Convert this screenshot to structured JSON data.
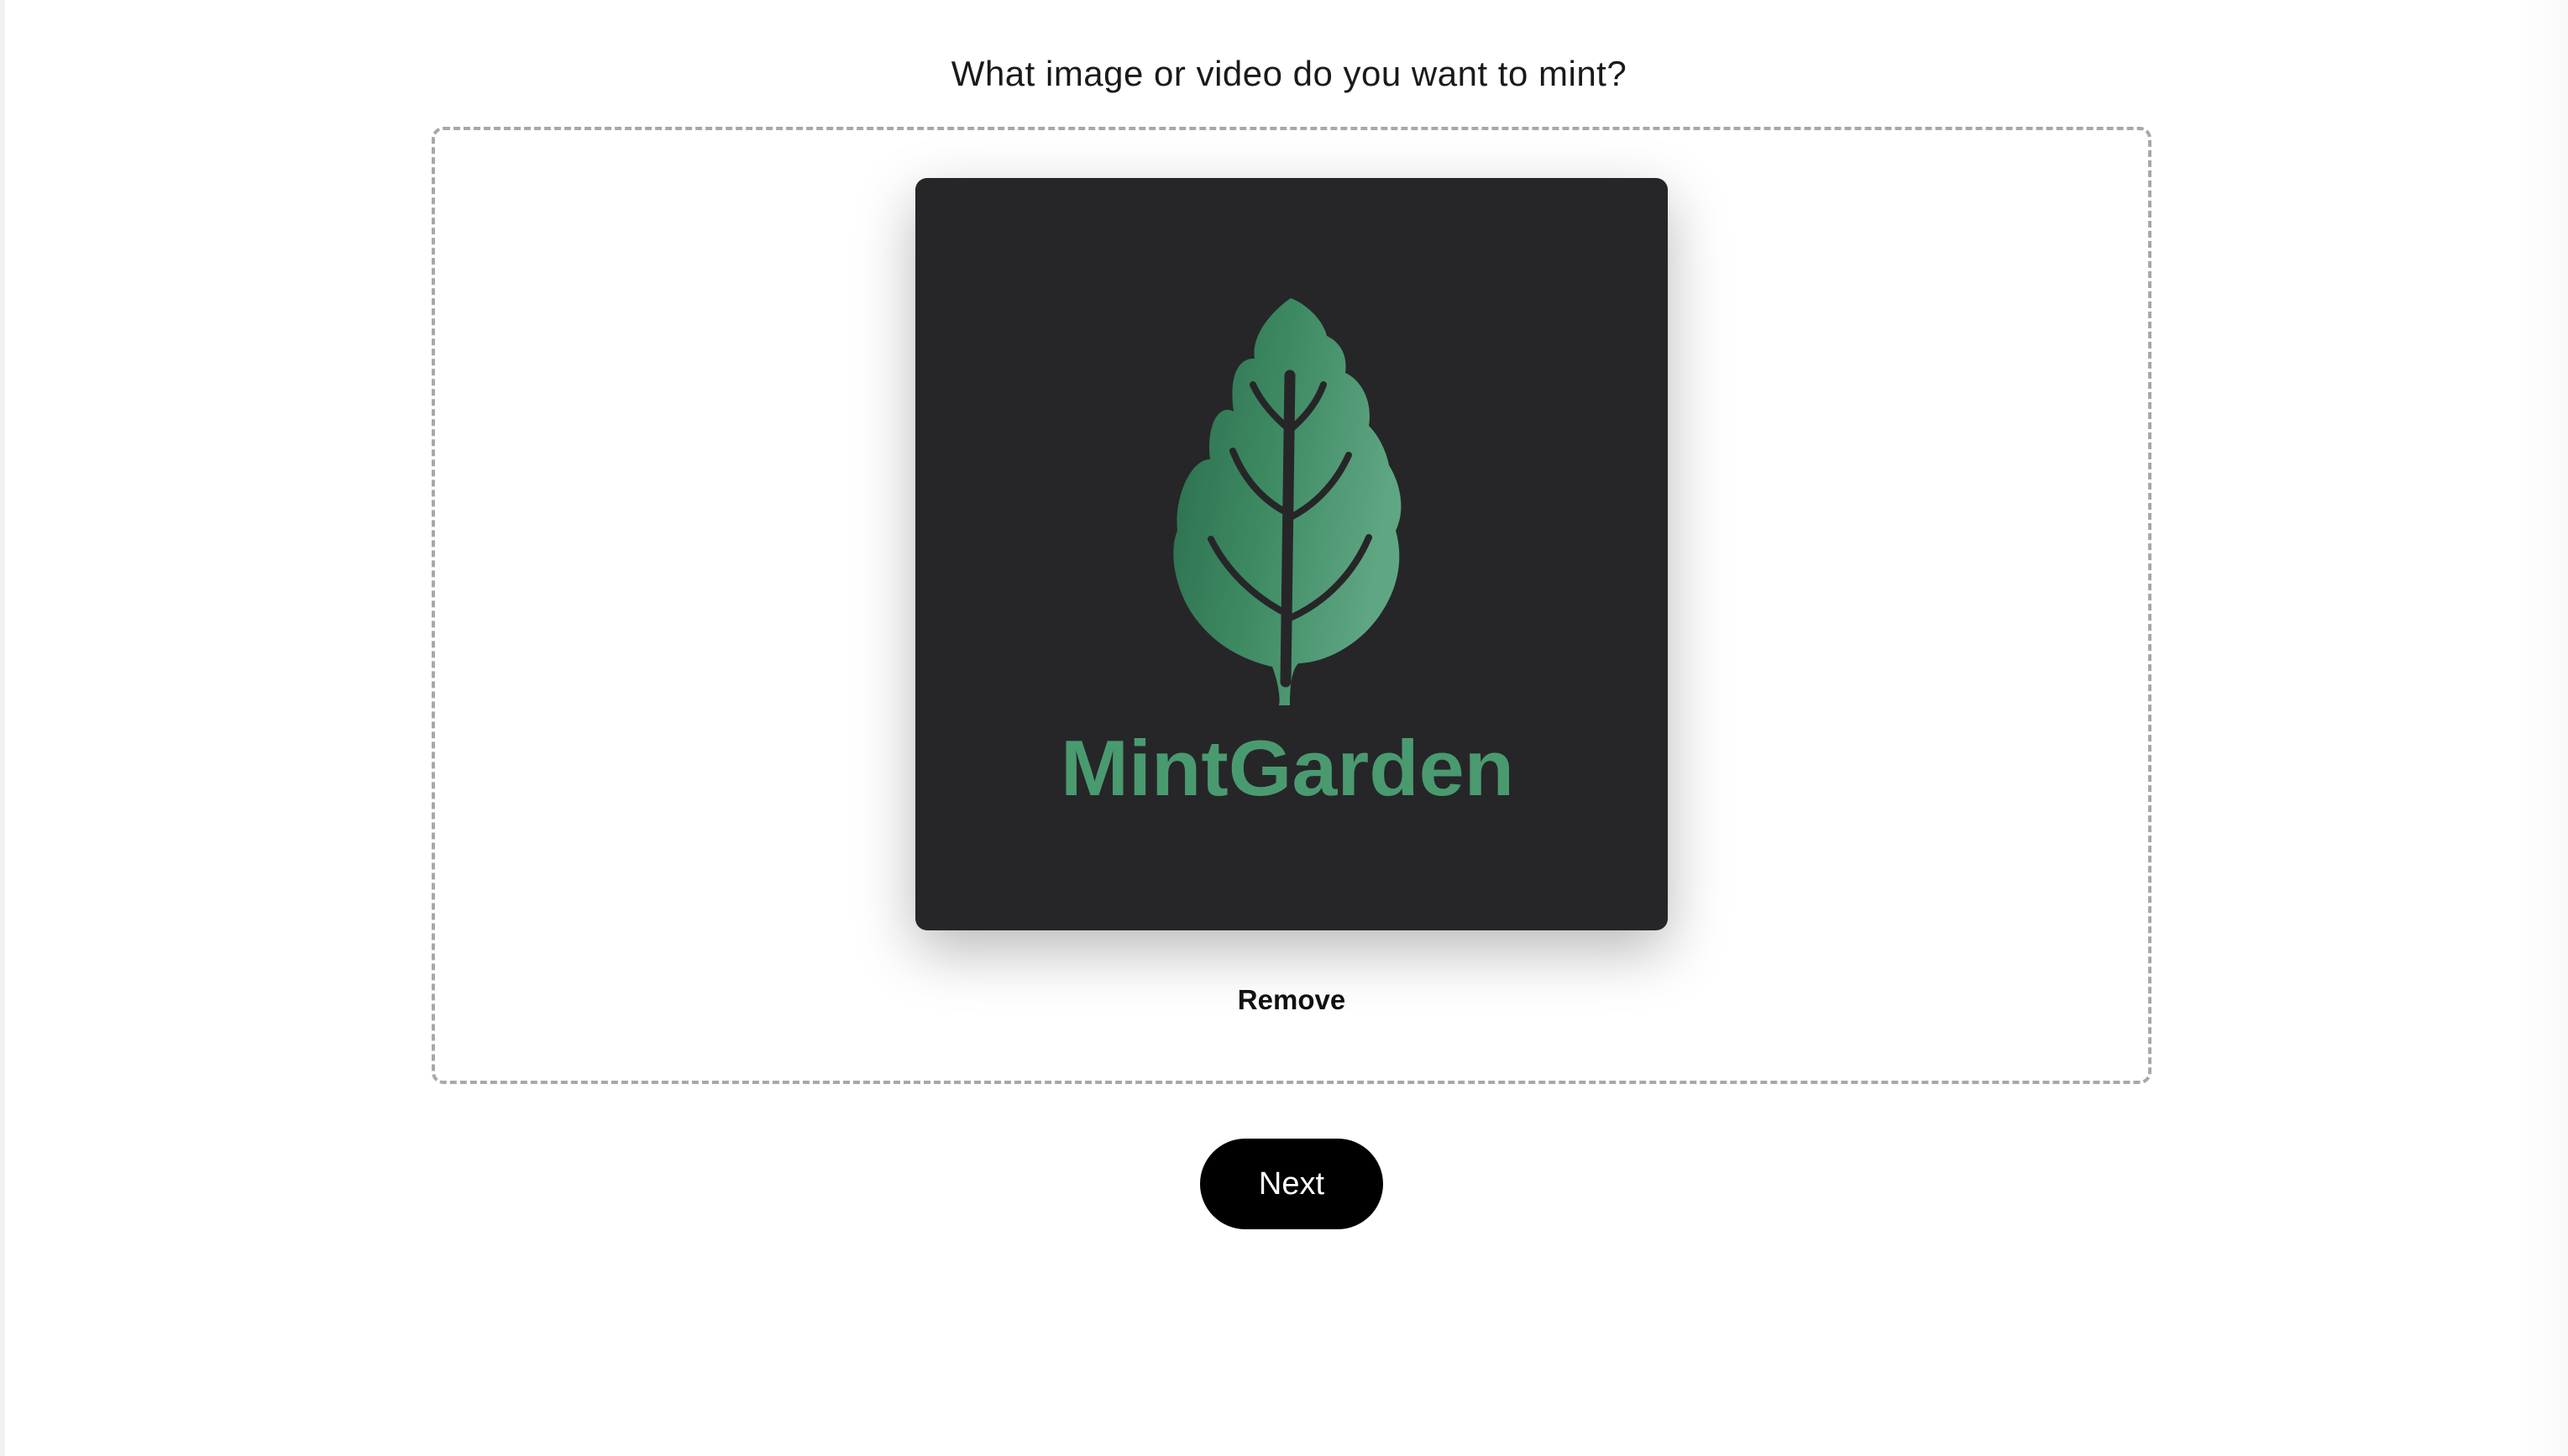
{
  "page": {
    "question": "What image or video do you want to mint?"
  },
  "preview": {
    "logo_text": "MintGarden",
    "logo_icon": "leaf-icon",
    "background_color": "#262628",
    "brand_color": "#4a9a70"
  },
  "actions": {
    "remove_label": "Remove",
    "next_label": "Next"
  }
}
